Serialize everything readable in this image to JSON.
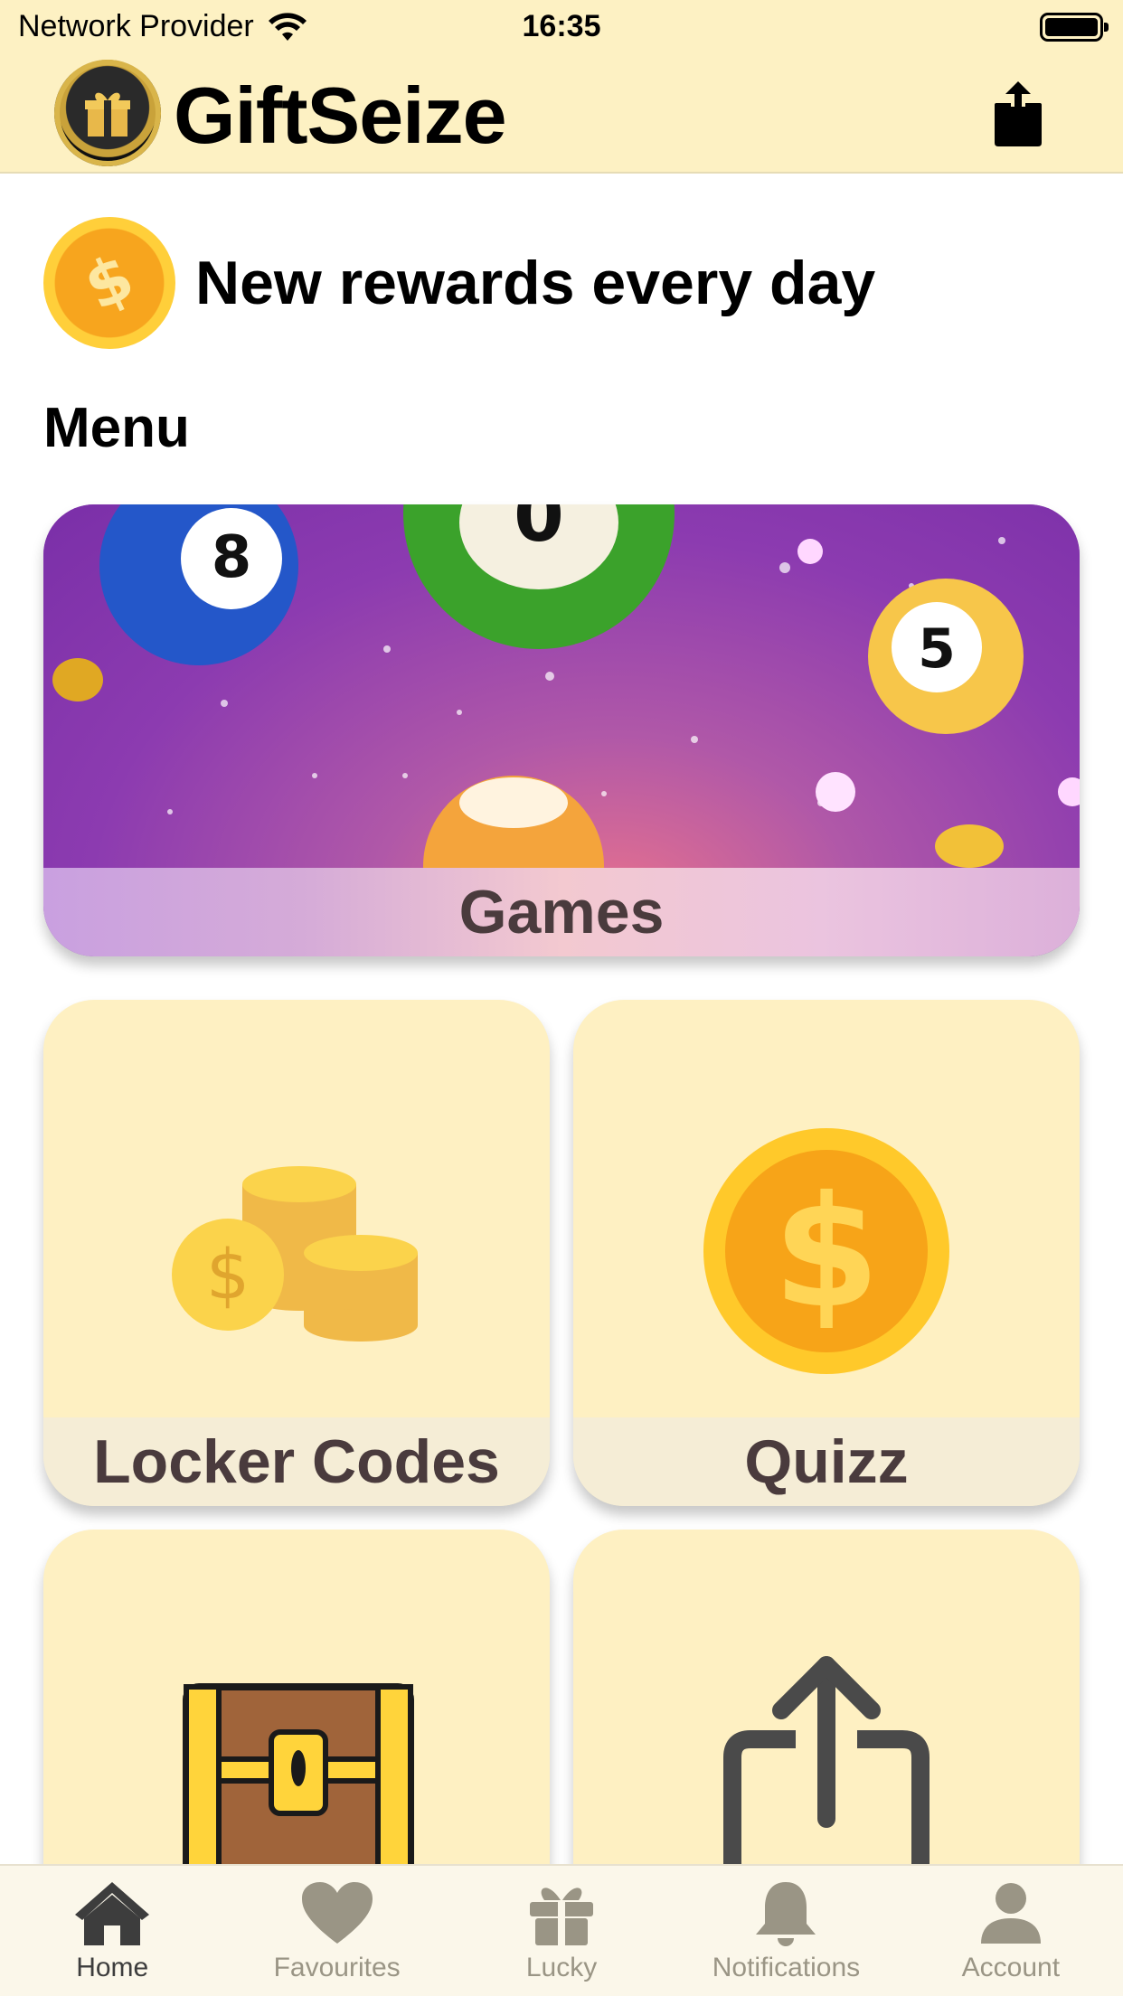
{
  "status_bar": {
    "provider": "Network Provider",
    "time": "16:35"
  },
  "header": {
    "app_name": "GiftSeize",
    "share_icon": "share-icon"
  },
  "banner": {
    "text": "New rewards every day",
    "icon": "dollar-coin-icon"
  },
  "menu": {
    "title": "Menu",
    "cards": [
      {
        "label": "Games",
        "icon": "lottery-balls-image"
      },
      {
        "label": "Locker Codes",
        "icon": "coin-stacks-icon"
      },
      {
        "label": "Quizz",
        "icon": "dollar-coin-icon"
      },
      {
        "label": "",
        "icon": "treasure-chest-icon"
      },
      {
        "label": "",
        "icon": "share-icon"
      }
    ]
  },
  "tabbar": {
    "items": [
      {
        "label": "Home",
        "icon": "home-icon",
        "active": true
      },
      {
        "label": "Favourites",
        "icon": "heart-icon",
        "active": false
      },
      {
        "label": "Lucky",
        "icon": "gift-icon",
        "active": false
      },
      {
        "label": "Notifications",
        "icon": "bell-icon",
        "active": false
      },
      {
        "label": "Account",
        "icon": "person-icon",
        "active": false
      }
    ]
  },
  "colors": {
    "header_bg": "#fdf1c3",
    "card_bg": "#fef0c2",
    "label_text": "#4a3b3d",
    "tab_active": "#3d3d3d",
    "tab_inactive": "#9a9585"
  }
}
